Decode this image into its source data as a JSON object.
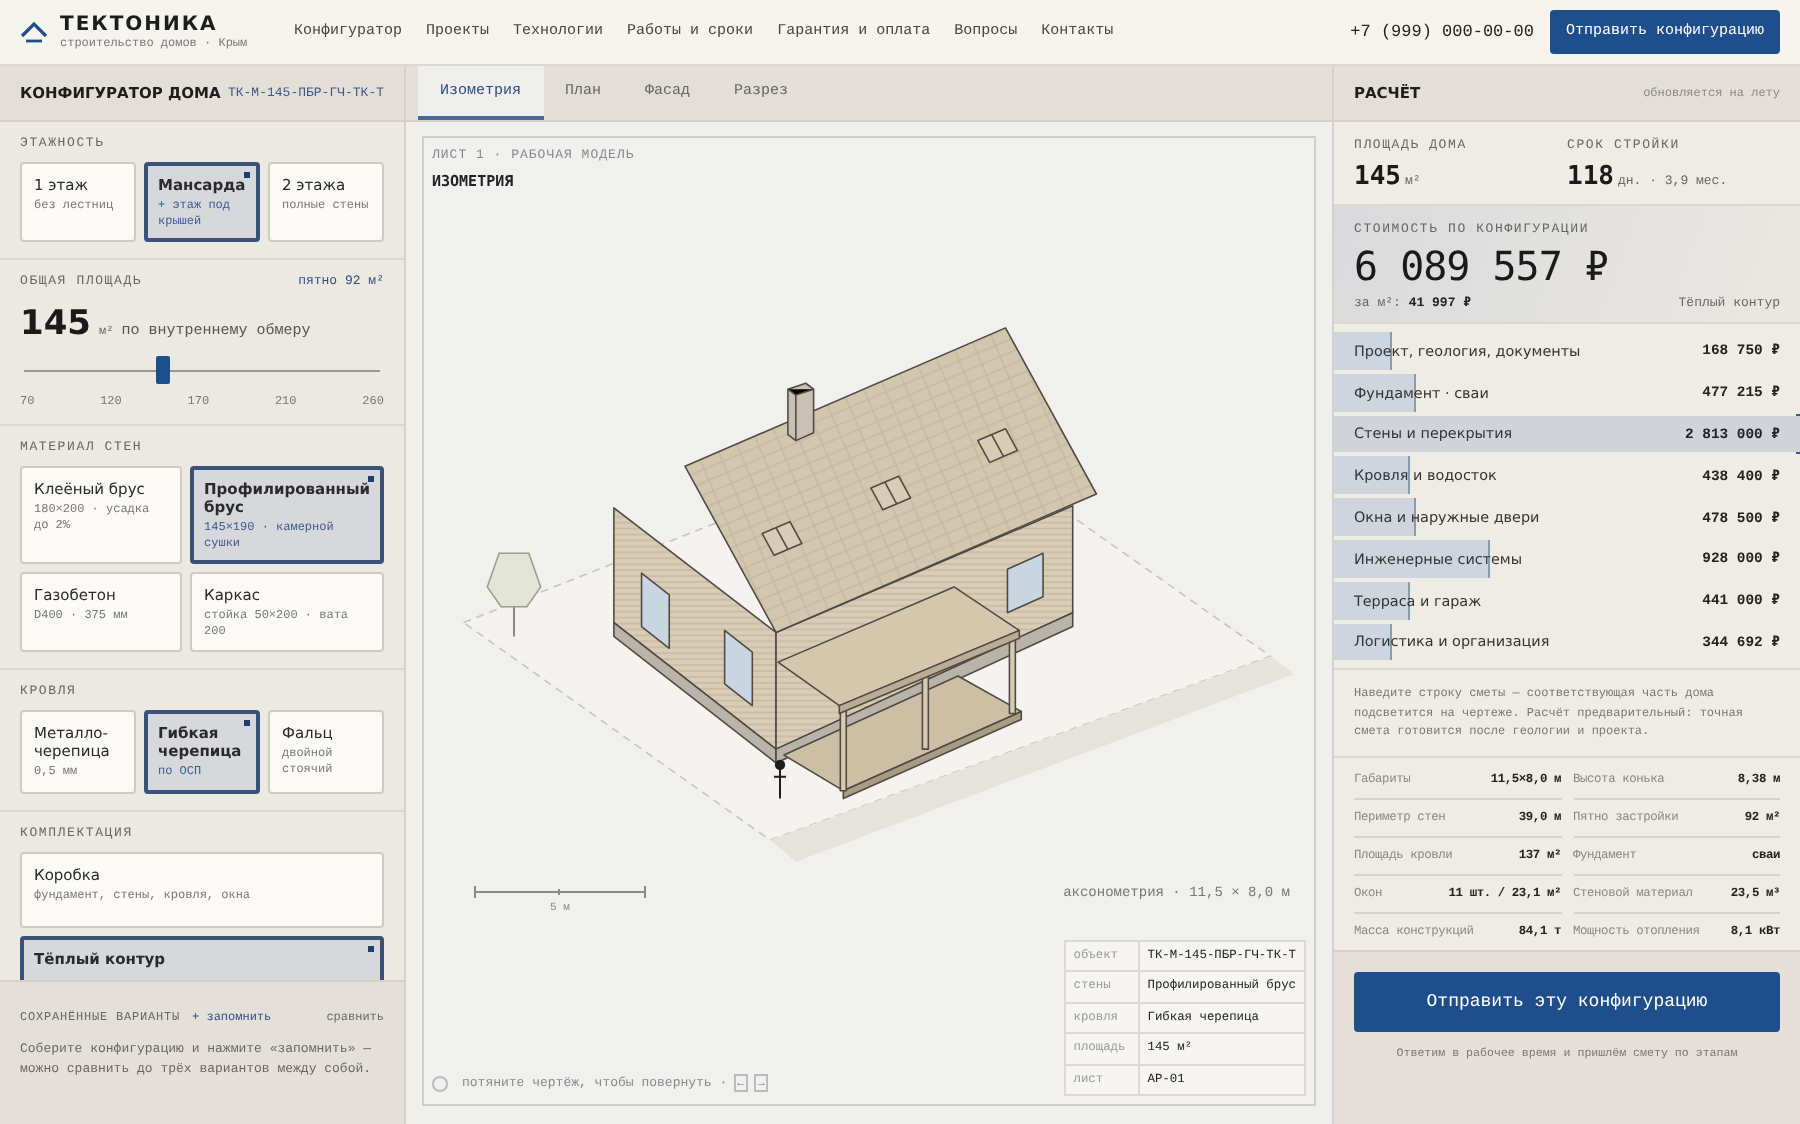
{
  "header": {
    "brand": "ТЕКТОНИКА",
    "tagline": "строительство домов · Крым",
    "nav": [
      {
        "label": "Конфигуратор"
      },
      {
        "label": "Проекты"
      },
      {
        "label": "Технологии"
      },
      {
        "label": "Работы и сроки"
      },
      {
        "label": "Гарантия и оплата"
      },
      {
        "label": "Вопросы"
      },
      {
        "label": "Контакты"
      }
    ],
    "phone": "+7 (999) 000-00-00",
    "cta": "Отправить конфигурацию"
  },
  "configurator": {
    "title": "КОНФИГУРАТОР ДОМА",
    "code": "ТК-М-145-ПБР-ГЧ-ТК-Т",
    "floors": {
      "label": "ЭТАЖНОСТЬ",
      "options": [
        {
          "title": "1 этаж",
          "subtitle": "без лестниц",
          "selected": false
        },
        {
          "title": "Мансарда",
          "subtitle": "+ этаж под крышей",
          "selected": true
        },
        {
          "title": "2 этажа",
          "subtitle": "полные стены",
          "selected": false
        }
      ]
    },
    "area": {
      "label": "ОБЩАЯ ПЛОЩАДЬ",
      "footprint": "пятно 92 м²",
      "value": "145",
      "unit": "м²",
      "note": "по внутреннему обмеру",
      "level": 0.39,
      "ticks": [
        "70",
        "120",
        "170",
        "210",
        "260"
      ]
    },
    "walls": {
      "label": "МАТЕРИАЛ СТЕН",
      "options": [
        {
          "title": "Клеёный брус",
          "subtitle": "180×200 · усадка до 2%",
          "selected": false
        },
        {
          "title": "Профилированный брус",
          "subtitle": "145×190 · камерной сушки",
          "selected": true
        },
        {
          "title": "Газобетон",
          "subtitle": "D400 · 375 мм",
          "selected": false
        },
        {
          "title": "Каркас",
          "subtitle": "стойка 50×200 · вата 200",
          "selected": false
        }
      ]
    },
    "roof": {
      "label": "КРОВЛЯ",
      "options": [
        {
          "title": "Металло-черепица",
          "subtitle": "0,5 мм",
          "selected": false
        },
        {
          "title": "Гибкая черепица",
          "subtitle": "по ОСП",
          "selected": true
        },
        {
          "title": "Фальц",
          "subtitle": "двойной стоячий",
          "selected": false
        }
      ]
    },
    "package": {
      "label": "КОМПЛЕКТАЦИЯ",
      "options": [
        {
          "title": "Коробка",
          "subtitle": "фундамент, стены, кровля, окна",
          "selected": false
        },
        {
          "title": "Тёплый контур",
          "selected": true
        }
      ]
    },
    "saved": {
      "label": "СОХРАНЁННЫЕ ВАРИАНТЫ",
      "save": "+ запомнить",
      "compare": "сравнить",
      "hint": "Соберите конфигурацию и нажмите «запомнить» — можно сравнить до трёх вариантов между собой."
    }
  },
  "viewer": {
    "tabs": [
      {
        "label": "Изометрия",
        "selected": true
      },
      {
        "label": "План",
        "selected": false
      },
      {
        "label": "Фасад",
        "selected": false
      },
      {
        "label": "Разрез",
        "selected": false
      }
    ],
    "sheet": "ЛИСТ 1 · РАБОЧАЯ МОДЕЛЬ",
    "title": "ИЗОМЕТРИЯ",
    "scale": "5 м",
    "projection": "аксонометрия · 11,5 × 8,0 м",
    "title_block": [
      {
        "label": "объект",
        "value": "ТК-М-145-ПБР-ГЧ-ТК-Т"
      },
      {
        "label": "стены",
        "value": "Профилированный брус"
      },
      {
        "label": "кровля",
        "value": "Гибкая черепица"
      },
      {
        "label": "площадь",
        "value": "145 м²"
      },
      {
        "label": "лист",
        "value": "АР-01"
      }
    ],
    "hint": "потяните чертёж, чтобы повернуть ·",
    "arrows": [
      "←",
      "→"
    ]
  },
  "estimate": {
    "title": "РАСЧЁТ",
    "status": "обновляется на лету",
    "stats": [
      {
        "label": "ПЛОЩАДЬ ДОМА",
        "value": "145",
        "unit": "м²"
      },
      {
        "label": "СРОК СТРОЙКИ",
        "value": "118",
        "unit": "дн. · 3,9 мес."
      }
    ],
    "cost_label": "СТОИМОСТЬ ПО КОНФИГУРАЦИИ",
    "total": "6 089 557 ₽",
    "per_m2": "за м²: **41 997 ₽**",
    "package": "Тёплый контур",
    "rows": [
      {
        "label": "Проект, геология, документы",
        "value": "168 750 ₽",
        "level": 0.12,
        "highlighted": false
      },
      {
        "label": "Фундамент · сваи",
        "value": "477 215 ₽",
        "level": 0.17,
        "highlighted": false
      },
      {
        "label": "Стены и перекрытия",
        "value": "2 813 000 ₽",
        "level": 1,
        "highlighted": true
      },
      {
        "label": "Кровля и водосток",
        "value": "438 400 ₽",
        "level": 0.16,
        "highlighted": false
      },
      {
        "label": "Окна и наружные двери",
        "value": "478 500 ₽",
        "level": 0.17,
        "highlighted": false
      },
      {
        "label": "Инженерные системы",
        "value": "928 000 ₽",
        "level": 0.33,
        "highlighted": false
      },
      {
        "label": "Терраса и гараж",
        "value": "441 000 ₽",
        "level": 0.16,
        "highlighted": false
      },
      {
        "label": "Логистика и организация",
        "value": "344 692 ₽",
        "level": 0.12,
        "highlighted": false
      }
    ],
    "note": "Наведите строку сметы — соответствующая часть дома подсветится на чертеже. Расчёт предварительный: точная смета готовится после геологии и проекта.",
    "specs": [
      {
        "label": "Габариты",
        "value": "11,5×8,0 м"
      },
      {
        "label": "Высота конька",
        "value": "8,38 м"
      },
      {
        "label": "Периметр стен",
        "value": "39,0 м"
      },
      {
        "label": "Пятно застройки",
        "value": "92 м²"
      },
      {
        "label": "Площадь кровли",
        "value": "137 м²"
      },
      {
        "label": "Фундамент",
        "value": "сваи"
      },
      {
        "label": "Окон",
        "value": "11 шт. / 23,1 м²"
      },
      {
        "label": "Стеновой материал",
        "value": "23,5 м³"
      },
      {
        "label": "Масса конструкций",
        "value": "84,1 т"
      },
      {
        "label": "Мощность отопления",
        "value": "8,1 кВт"
      }
    ],
    "submit": "Отправить эту конфигурацию",
    "footnote": "Ответим в рабочее время и пришлём смету по этапам"
  }
}
